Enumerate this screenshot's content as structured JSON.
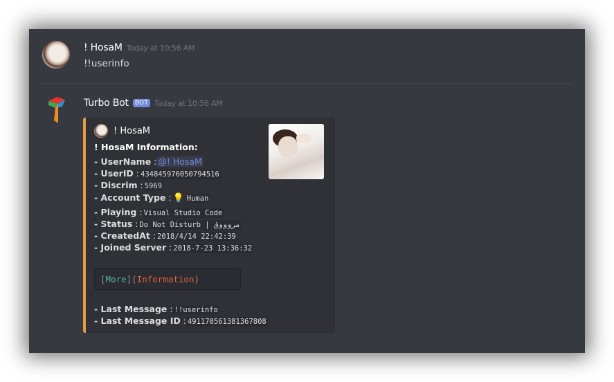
{
  "colors": {
    "window_bg": "#36393f",
    "embed_bg": "#2f3136",
    "embed_accent": "#e59c46",
    "bot_tag": "#7289da",
    "mention": "#7289da",
    "timestamp": "#72767d",
    "code_more": "#4fb6a5",
    "code_information": "#e2633d"
  },
  "message_user": {
    "author": "! HosaM",
    "timestamp": "Today at 10:56 AM",
    "content": "!!userinfo",
    "avatar_icon": "user-avatar"
  },
  "message_bot": {
    "author": "Turbo Bot",
    "bot_tag": "BOT",
    "timestamp": "Today at 10:56 AM",
    "avatar_icon": "turbo-logo-icon",
    "embed": {
      "author_name": "! HosaM",
      "title": "! HosaM Information:",
      "fields": {
        "username_label": "- UserName",
        "username_value": "@! HosaM",
        "userid_label": "- UserID",
        "userid_value": "434845976050794516",
        "discrim_label": "- Discrim",
        "discrim_value": "5969",
        "account_type_label": "- Account Type",
        "account_type_icon": "lightbulb-icon",
        "account_type_value": "Human",
        "playing_label": "- Playing",
        "playing_value": "Visual Studio Code",
        "status_label": "- Status",
        "status_value": "Do Not Disturb | مروووق",
        "created_label": "- CreatedAt",
        "created_value": "2018/4/14 22:42:39",
        "joined_label": "- Joined Server",
        "joined_value": "2018-7-23 13:36:32",
        "last_message_label": "- Last Message",
        "last_message_value": "!!userinfo",
        "last_message_id_label": "- Last Message ID",
        "last_message_id_value": "491170561381367808"
      },
      "codeblock": {
        "open_bracket": "[",
        "more": "More",
        "mid": "](",
        "information": "Information",
        "close": ")"
      },
      "separator": ":"
    }
  }
}
